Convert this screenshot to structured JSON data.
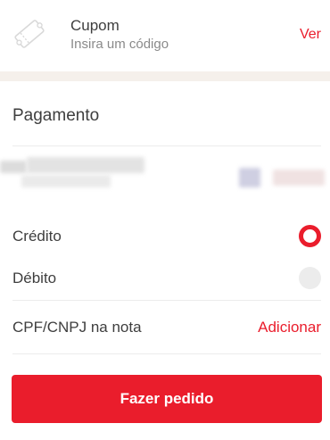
{
  "coupon": {
    "icon": "ticket-icon",
    "title": "Cupom",
    "subtitle": "Insira um código",
    "action_label": "Ver"
  },
  "payment": {
    "title": "Pagamento",
    "card_details_redacted": true,
    "options": [
      {
        "label": "Crédito",
        "selected": true
      },
      {
        "label": "Débito",
        "selected": false
      }
    ],
    "tax_id": {
      "label": "CPF/CNPJ na nota",
      "action_label": "Adicionar"
    }
  },
  "submit": {
    "label": "Fazer pedido"
  },
  "colors": {
    "accent": "#ea1d2c",
    "text": "#3e3e3e",
    "muted_text": "#8a8a8a",
    "band": "#f5f0eb",
    "radio_off": "#ececec"
  }
}
